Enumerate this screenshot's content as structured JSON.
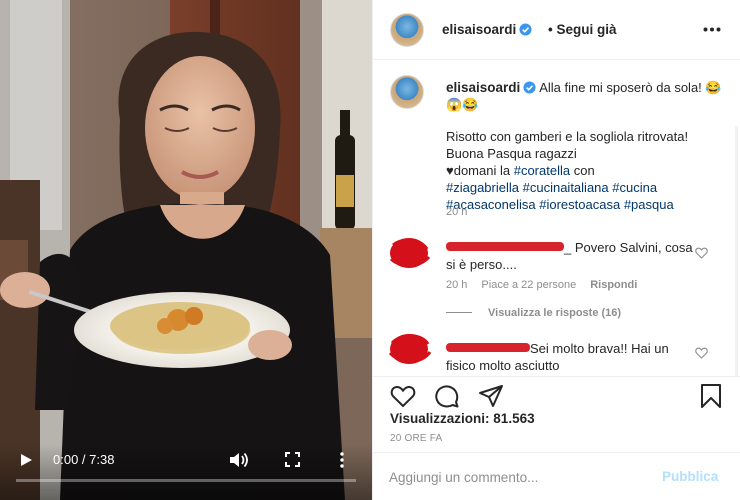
{
  "post": {
    "username": "elisaisoardi",
    "follow_status": "• Segui già",
    "caption_lead": "Alla fine mi sposerò da sola! 😂😱😂",
    "caption_line1": "Risotto con gamberi e la sogliola ritrovata! Buona Pasqua ragazzi",
    "caption_line2": "♥domani la",
    "hashtags": [
      "#coratella",
      "#ziagabriella",
      "#cucinaitaliana",
      "#cucina",
      "#acasaconelisa",
      "#iorestoacasa",
      "#pasqua"
    ],
    "caption_con": "con",
    "caption_time": "20 h"
  },
  "comments": [
    {
      "text": "_ Povero Salvini, cosa si è perso....",
      "time": "20 h",
      "likes": "Piace a 22 persone",
      "reply": "Rispondi",
      "replies_toggle": "Visualizza le risposte (16)"
    },
    {
      "text": "Sei molto brava!! Hai un fisico molto asciutto"
    }
  ],
  "stats": {
    "views_label": "Visualizzazioni:",
    "views_value": "81.563",
    "date": "20 ORE FA"
  },
  "composer": {
    "placeholder": "Aggiungi un commento...",
    "publish_label": "Pubblica"
  },
  "video": {
    "time": "0:00 / 7:38",
    "progress": 0
  },
  "colors": {
    "link": "#00376b",
    "verified": "#3897f0",
    "publish_disabled": "#b2dffc",
    "redaction": "#d4111a"
  }
}
